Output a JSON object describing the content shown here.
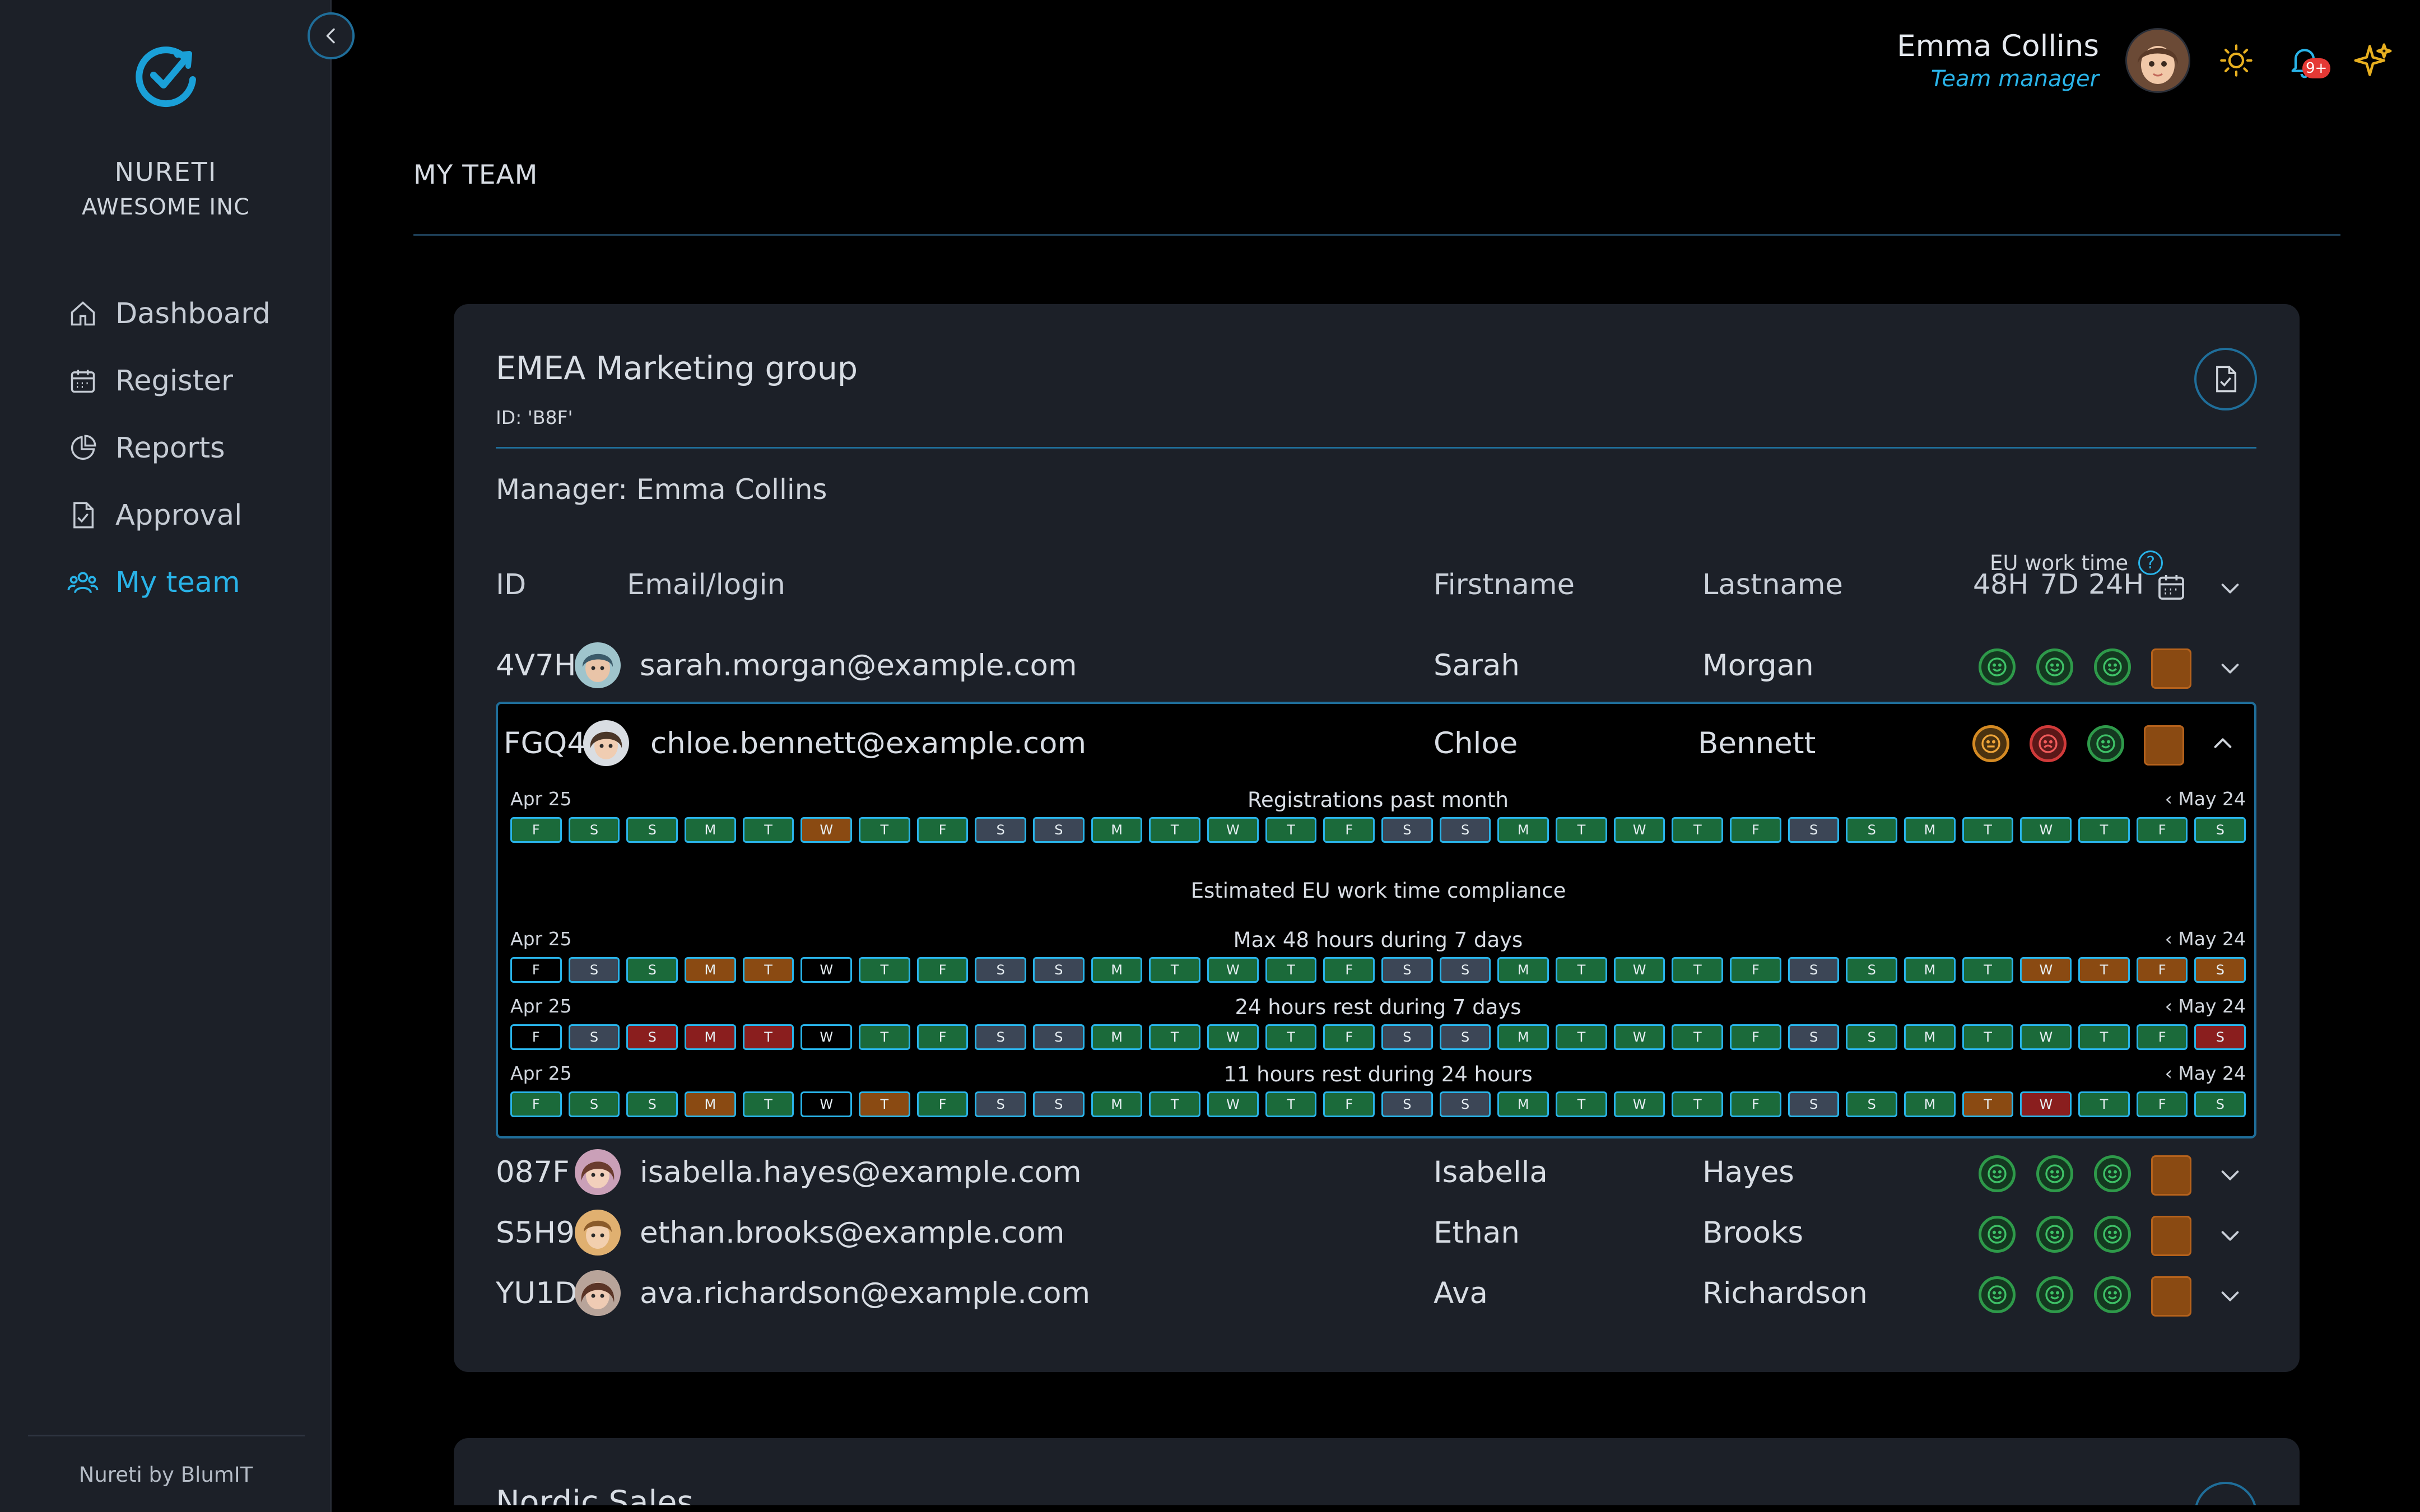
{
  "sidebar": {
    "brand": "NURETI",
    "company": "AWESOME INC",
    "nav": [
      {
        "label": "Dashboard",
        "icon": "home-icon"
      },
      {
        "label": "Register",
        "icon": "calendar-icon"
      },
      {
        "label": "Reports",
        "icon": "pie-chart-icon"
      },
      {
        "label": "Approval",
        "icon": "document-check-icon"
      },
      {
        "label": "My team",
        "icon": "users-icon",
        "active": true
      }
    ],
    "footer": "Nureti by BlumIT"
  },
  "header": {
    "user_name": "Emma Collins",
    "user_role": "Team manager",
    "notification_badge": "9+"
  },
  "page_title": "MY TEAM",
  "group": {
    "name": "EMEA Marketing group",
    "id_text": "ID: 'B8F'",
    "manager": "Manager: Emma Collins",
    "eu_title": "EU work time",
    "columns": {
      "id": "ID",
      "email": "Email/login",
      "firstname": "Firstname",
      "lastname": "Lastname",
      "r48": "48H",
      "r7d": "7D",
      "r24": "24H"
    },
    "members": [
      {
        "id": "4V7H",
        "email": "sarah.morgan@example.com",
        "first": "Sarah",
        "last": "Morgan",
        "status": [
          "good",
          "good",
          "good"
        ]
      },
      {
        "id": "FGQ4",
        "email": "chloe.bennett@example.com",
        "first": "Chloe",
        "last": "Bennett",
        "status": [
          "warn",
          "bad",
          "good"
        ]
      },
      {
        "id": "087F",
        "email": "isabella.hayes@example.com",
        "first": "Isabella",
        "last": "Hayes",
        "status": [
          "good",
          "good",
          "good"
        ]
      },
      {
        "id": "S5H9",
        "email": "ethan.brooks@example.com",
        "first": "Ethan",
        "last": "Brooks",
        "status": [
          "good",
          "good",
          "good"
        ]
      },
      {
        "id": "YU1D",
        "email": "ava.richardson@example.com",
        "first": "Ava",
        "last": "Richardson",
        "status": [
          "good",
          "good",
          "good"
        ]
      }
    ],
    "detail": {
      "range_start": "Apr 25",
      "range_end": "‹ May 24",
      "registrations_title": "Registrations past month",
      "compliance_title": "Estimated EU work time compliance",
      "rule1_title": "Max 48 hours during 7 days",
      "rule2_title": "24 hours rest during 7 days",
      "rule3_title": "11 hours rest during 24 hours",
      "days": [
        "F",
        "S",
        "S",
        "M",
        "T",
        "W",
        "T",
        "F",
        "S",
        "S",
        "M",
        "T",
        "W",
        "T",
        "F",
        "S",
        "S",
        "M",
        "T",
        "W",
        "T",
        "F",
        "S",
        "S",
        "M",
        "T",
        "W",
        "T",
        "F",
        "S"
      ],
      "registrations": [
        "g",
        "g",
        "g",
        "g",
        "g",
        "o",
        "g",
        "g",
        "s",
        "s",
        "g",
        "g",
        "g",
        "g",
        "g",
        "s",
        "s",
        "g",
        "g",
        "g",
        "g",
        "g",
        "s",
        "g",
        "g",
        "g",
        "g",
        "g",
        "g",
        "g"
      ],
      "rule1": [
        "b",
        "s",
        "g",
        "o",
        "o",
        "b",
        "g",
        "g",
        "s",
        "s",
        "g",
        "g",
        "g",
        "g",
        "g",
        "s",
        "s",
        "g",
        "g",
        "g",
        "g",
        "g",
        "s",
        "g",
        "g",
        "g",
        "o",
        "o",
        "o",
        "o"
      ],
      "rule2": [
        "b",
        "s",
        "r",
        "r",
        "r",
        "b",
        "g",
        "g",
        "s",
        "s",
        "g",
        "g",
        "g",
        "g",
        "g",
        "s",
        "s",
        "g",
        "g",
        "g",
        "g",
        "g",
        "s",
        "g",
        "g",
        "g",
        "g",
        "g",
        "g",
        "r"
      ],
      "rule3": [
        "g",
        "g",
        "g",
        "o",
        "g",
        "b",
        "o",
        "g",
        "s",
        "s",
        "g",
        "g",
        "g",
        "g",
        "g",
        "s",
        "s",
        "g",
        "g",
        "g",
        "g",
        "g",
        "s",
        "g",
        "g",
        "o",
        "r",
        "g",
        "g",
        "g"
      ]
    }
  },
  "next_group": {
    "name": "Nordic Sales"
  },
  "colors": {
    "accent": "#29b3e8",
    "good": "#2e9a4a",
    "warn": "#d48a23",
    "bad": "#d13a3a",
    "card": "#1c2028"
  }
}
